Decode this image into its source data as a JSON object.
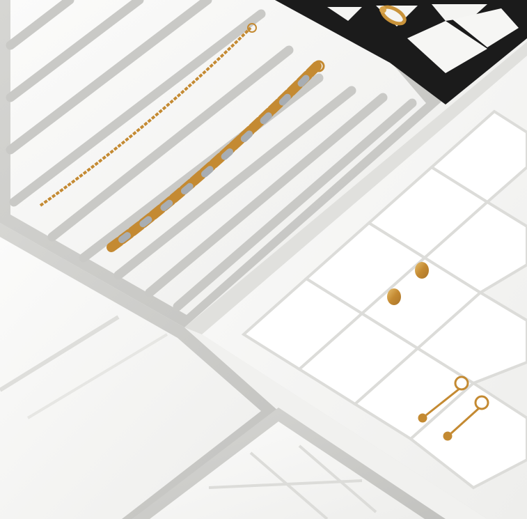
{
  "scene": {
    "description_visible_text": "",
    "colors": {
      "background": "#f3f3f1",
      "velvet_white": "#f7f7f5",
      "tray_gray": "#cfcfcc",
      "tray_gray_dark": "#b9b9b6",
      "tray_black": "#1a1a1a",
      "gold": "#c9933a",
      "gold_light": "#e2b865",
      "silver": "#9ea3a8"
    },
    "trays": [
      {
        "name": "bracelet-tray",
        "style": "gray-frame-with-bars"
      },
      {
        "name": "ring-tray-black",
        "style": "black-grid"
      },
      {
        "name": "earring-tray",
        "style": "white-grid"
      },
      {
        "name": "lower-left-tray",
        "style": "gray-frame"
      },
      {
        "name": "bottom-center-tray",
        "style": "gray-frame-grid"
      }
    ],
    "items": [
      {
        "name": "thin-gold-bracelet",
        "type": "bracelet"
      },
      {
        "name": "two-tone-chain-bracelet",
        "type": "bracelet"
      },
      {
        "name": "gold-ring",
        "type": "ring"
      },
      {
        "name": "gold-stud-earrings",
        "type": "earrings"
      },
      {
        "name": "gold-drop-earrings",
        "type": "earrings"
      }
    ]
  }
}
